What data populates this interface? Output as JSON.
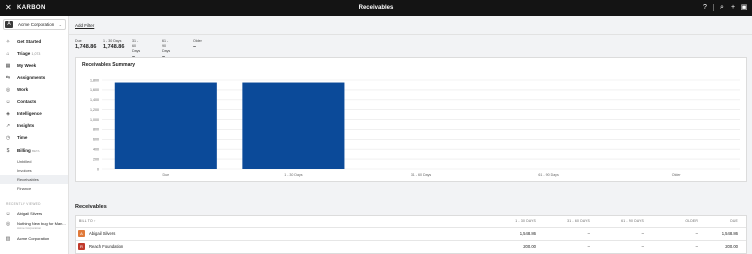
{
  "topbar": {
    "brand": "KARBON",
    "title": "Receivables",
    "icons": [
      "close-icon",
      "help-icon",
      "search-icon",
      "plus-icon",
      "inbox-icon"
    ]
  },
  "sidebar": {
    "workspace": {
      "avatar": "A",
      "name": "Acme Corporation"
    },
    "items": [
      {
        "label": "Get Started",
        "icon": "rocket-icon"
      },
      {
        "label": "Triage",
        "count": "1,073",
        "icon": "triage-icon"
      },
      {
        "label": "My Week",
        "icon": "calendar-icon"
      },
      {
        "label": "Assignments",
        "icon": "assignments-icon"
      },
      {
        "label": "Work",
        "icon": "work-icon"
      },
      {
        "label": "Contacts",
        "icon": "contacts-icon"
      },
      {
        "label": "Intelligence",
        "icon": "intelligence-icon"
      },
      {
        "label": "Insights",
        "icon": "insights-icon"
      },
      {
        "label": "Time",
        "icon": "clock-icon"
      },
      {
        "label": "Billing",
        "badge": "BETA",
        "icon": "billing-icon"
      }
    ],
    "billing_sub": [
      "Unbilled",
      "Invoices",
      "Receivables",
      "Finance"
    ],
    "recently_viewed_title": "RECENTLY VIEWED",
    "recently_viewed": [
      {
        "label": "Abigail Silvers",
        "icon": "person-icon"
      },
      {
        "label": "Nothing New bug for Man...",
        "sub": "Acme Corporation",
        "icon": "work-item-icon"
      },
      {
        "label": "Acme Corporation",
        "icon": "building-icon"
      }
    ]
  },
  "main": {
    "add_filter": "Add Filter",
    "stats": [
      {
        "label": "Due",
        "value": "1,748.86"
      },
      {
        "label": "1 - 30 Days",
        "value": "1,748.86"
      },
      {
        "label": "31 - 60 Days",
        "value": "–"
      },
      {
        "label": "61 - 90 Days",
        "value": "–"
      },
      {
        "label": "Older",
        "value": "–"
      }
    ],
    "chart_title": "Receivables Summary",
    "table_title": "Receivables",
    "table_headers": {
      "bill_to": "BILL TO",
      "sort_arrow": "↑",
      "d1_30": "1 - 30 DAYS",
      "d31_60": "31 - 60 DAYS",
      "d61_90": "61 - 90 DAYS",
      "older": "OLDER",
      "due": "DUE"
    },
    "rows": [
      {
        "avatar": "A",
        "avatar_color": "#e07a3a",
        "name": "Abigail Silvers",
        "d1_30": "1,548.86",
        "d31_60": "–",
        "d61_90": "–",
        "older": "–",
        "due": "1,548.86"
      },
      {
        "avatar": "R",
        "avatar_color": "#c0392b",
        "name": "Reach Foundation",
        "d1_30": "200.00",
        "d31_60": "–",
        "d61_90": "–",
        "older": "–",
        "due": "200.00"
      }
    ]
  },
  "chart_data": {
    "type": "bar",
    "title": "Receivables Summary",
    "categories": [
      "Due",
      "1 - 30 Days",
      "31 - 60 Days",
      "61 - 90 Days",
      "Older"
    ],
    "values": [
      1748.86,
      1748.86,
      0,
      0,
      0
    ],
    "ylim": [
      0,
      1800
    ],
    "yticks": [
      0,
      200,
      400,
      600,
      800,
      1000,
      1200,
      1400,
      1600,
      1800
    ],
    "ytick_labels": [
      "0",
      "200",
      "400",
      "600",
      "800",
      "1,000",
      "1,200",
      "1,400",
      "1,600",
      "1,800"
    ],
    "grid": true,
    "bar_color": "#0b4a99"
  }
}
